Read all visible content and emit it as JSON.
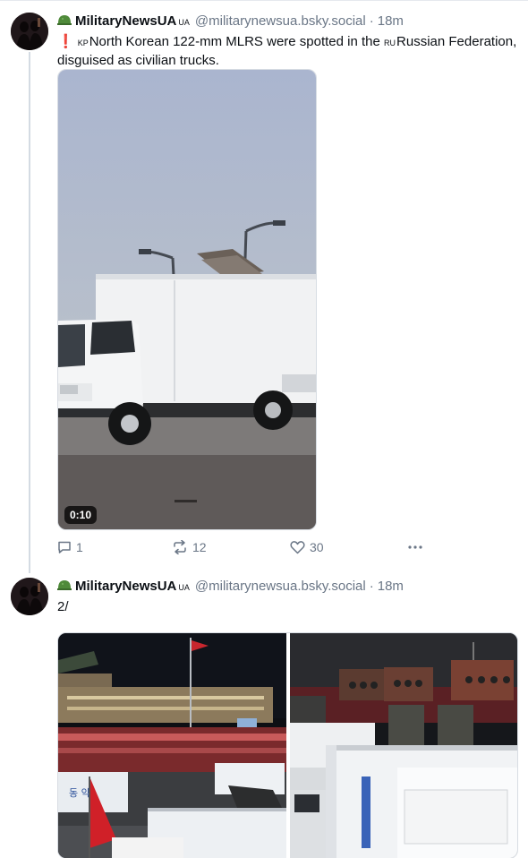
{
  "posts": [
    {
      "author_name": "MilitaryNewsUA",
      "author_flag": "UA",
      "handle": "@militarynewsua.bsky.social",
      "separator": "·",
      "time": "18m",
      "text_bang": "❗",
      "text_flag1": "KP",
      "text_part1": "North Korean 122-mm MLRS were spotted in the ",
      "text_flag2": "RU",
      "text_part2": "Russian Federation, disguised as civilian trucks.",
      "video_duration": "0:10",
      "reply_count": "1",
      "repost_count": "12",
      "like_count": "30"
    },
    {
      "author_name": "MilitaryNewsUA",
      "author_flag": "UA",
      "handle": "@militarynewsua.bsky.social",
      "separator": "·",
      "time": "18m",
      "text": "2/"
    }
  ],
  "icons": {
    "helmet": "helmet-emoji",
    "reply": "reply-icon",
    "repost": "repost-icon",
    "like": "heart-icon",
    "more": "more-icon"
  },
  "colors": {
    "accent": "#1083fe",
    "muted": "#6a7686",
    "alert": "#e0245e"
  }
}
